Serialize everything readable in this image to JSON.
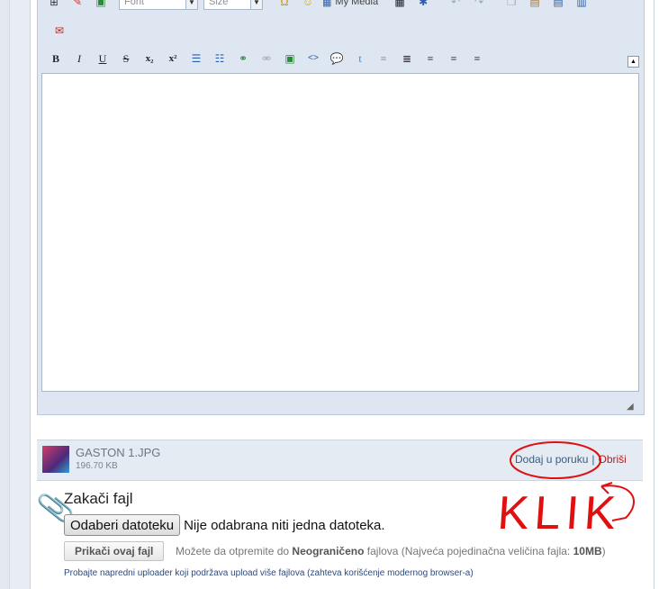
{
  "toolbar": {
    "font_select": "Font",
    "size_select": "Size",
    "my_media_label": "My Media",
    "format_buttons": [
      "B",
      "I",
      "U",
      "S",
      "x₂",
      "x²"
    ]
  },
  "attachment": {
    "filename": "GASTON 1.JPG",
    "filesize": "196.70 KB",
    "insert_link": "Dodaj u poruku",
    "separator": "|",
    "delete_link": "Obriši"
  },
  "upload": {
    "heading": "Zakači fajl",
    "choose_button": "Odaberi datoteku",
    "no_file_text": "Nije odabrana niti jedna datoteka.",
    "attach_button": "Prikači ovaj fajl",
    "info_prefix": "Možete da otpremite do",
    "info_unlimited": "Neograničeno",
    "info_middle": "fajlova (Najveća pojedinačna veličina fajla:",
    "info_size": "10MB",
    "info_suffix": ")",
    "advanced_link": "Probajte napredni uploader koji podržava upload više fajlova (zahteva korišćenje modernog browser-a)"
  },
  "annotation": {
    "text": "KLIK",
    "color": "#e01010"
  }
}
